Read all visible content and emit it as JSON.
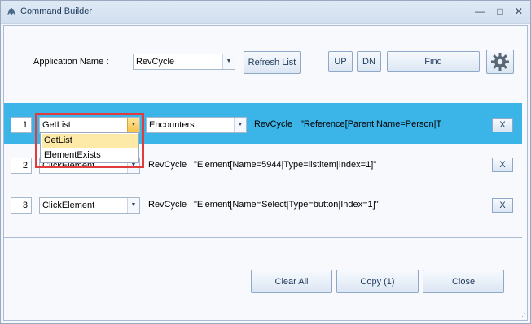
{
  "window": {
    "title": "Command Builder",
    "minimize": "—",
    "maximize": "□",
    "close": "✕"
  },
  "header": {
    "app_name_label": "Application Name :",
    "app_name_value": "RevCycle",
    "refresh_label": "Refresh List",
    "up_label": "UP",
    "dn_label": "DN",
    "find_label": "Find",
    "settings_icon": "gear-icon"
  },
  "rows": [
    {
      "index": "1",
      "command": "GetList",
      "target": "Encounters",
      "app": "RevCycle",
      "selector": "\"Reference[Parent|Name=Person|T",
      "remove": "X"
    },
    {
      "index": "2",
      "command": "ClickElement",
      "app": "RevCycle",
      "selector": "\"Element[Name=5944|Type=listitem|Index=1]\"",
      "remove": "X"
    },
    {
      "index": "3",
      "command": "ClickElement",
      "app": "RevCycle",
      "selector": "\"Element[Name=Select|Type=button|Index=1]\"",
      "remove": "X"
    }
  ],
  "dropdown": {
    "options": [
      "GetList",
      "ElementExists"
    ],
    "selected": "GetList"
  },
  "footer": {
    "clear_all": "Clear All",
    "copy": "Copy (1)",
    "close": "Close"
  },
  "colors": {
    "selected_row": "#3bb5e8",
    "highlight_border": "#e23b3b",
    "dropdown_selected": "#fde9a8"
  }
}
